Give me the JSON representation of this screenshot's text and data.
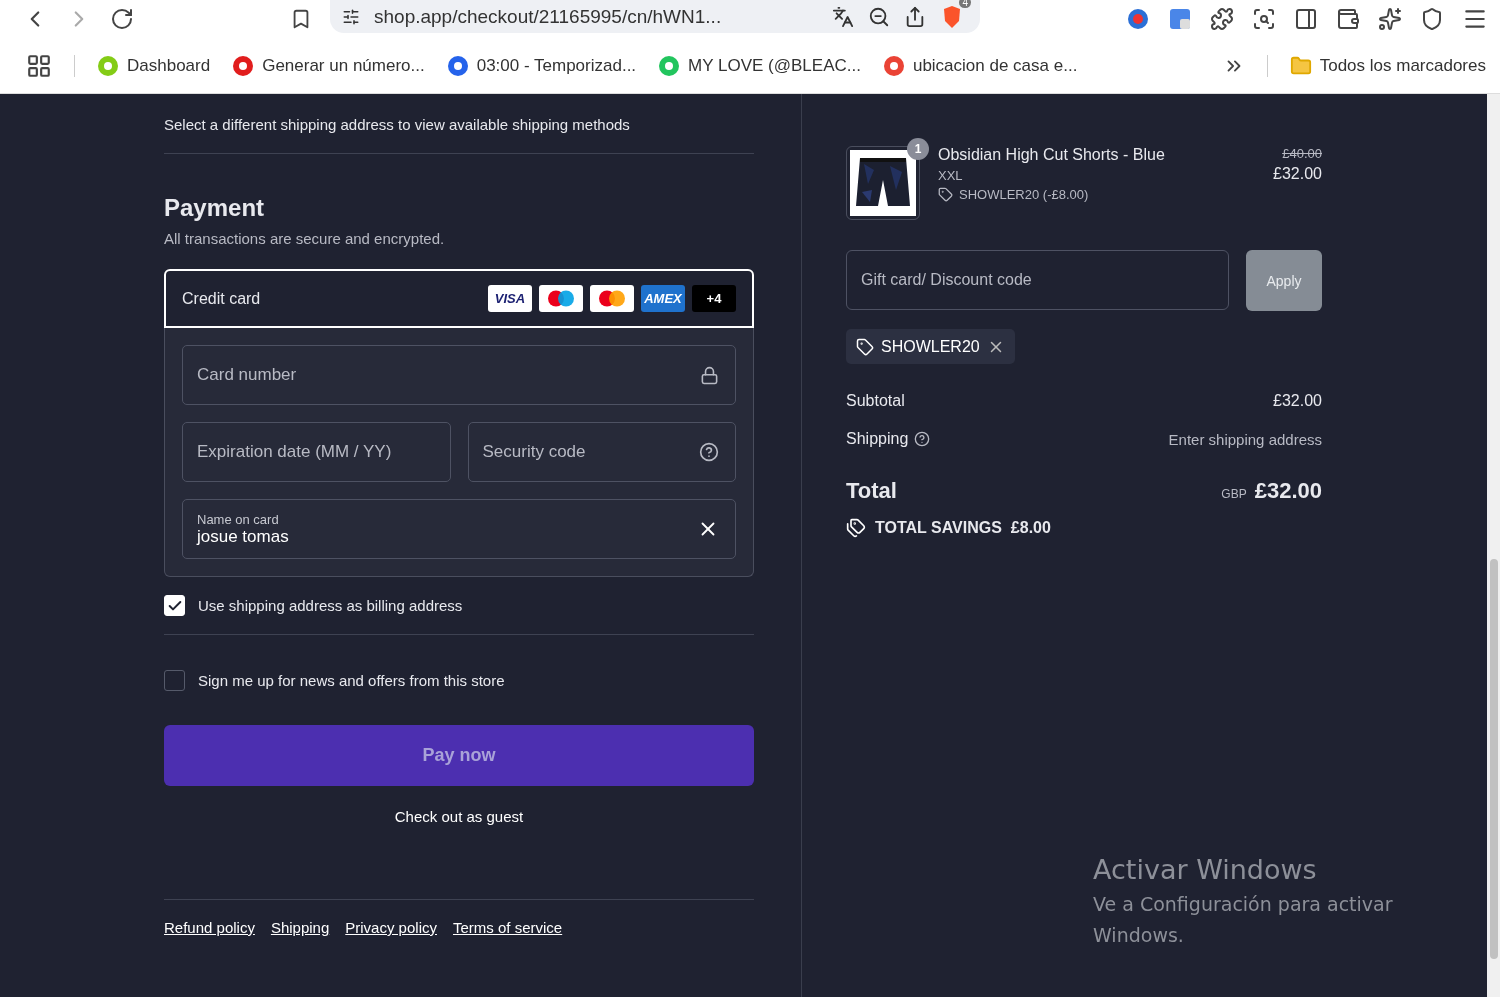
{
  "browser": {
    "url": "shop.app/checkout/21165995/cn/hWN1...",
    "extension_badge": "4",
    "bookmarks": [
      {
        "label": "Dashboard",
        "color": "#84cc16"
      },
      {
        "label": "Generar un número...",
        "color": "#e11d1d"
      },
      {
        "label": "03:00 - Temporizad...",
        "color": "#2563eb"
      },
      {
        "label": "MY LOVE (@BLEAC...",
        "color": "#22c55e"
      },
      {
        "label": "ubicacion de casa e...",
        "color": "#ea4335"
      }
    ],
    "all_bookmarks": "Todos los marcadores"
  },
  "shipping": {
    "message": "Select a different shipping address to view available shipping methods"
  },
  "payment": {
    "title": "Payment",
    "subtitle": "All transactions are secure and encrypted.",
    "method": {
      "label": "Credit card",
      "selected": true,
      "cards": [
        {
          "kind": "visa",
          "label": "VISA"
        },
        {
          "kind": "maestro"
        },
        {
          "kind": "mastercard"
        },
        {
          "kind": "amex",
          "label": "AMEX"
        },
        {
          "kind": "more",
          "label": "+4"
        }
      ]
    },
    "card_number": {
      "placeholder": "Card number"
    },
    "expiration": {
      "placeholder": "Expiration date (MM / YY)"
    },
    "security_code": {
      "placeholder": "Security code"
    },
    "name_on_card": {
      "label": "Name on card",
      "value": "josue tomas"
    }
  },
  "billing_same": {
    "label": "Use shipping address as billing address",
    "checked": true
  },
  "newsletter": {
    "label": "Sign me up for news and offers from this store",
    "checked": false
  },
  "pay_button": {
    "label": "Pay now",
    "disabled": true
  },
  "guest_link": "Check out as guest",
  "footer_links": [
    "Refund policy",
    "Shipping",
    "Privacy policy",
    "Terms of service"
  ],
  "summary": {
    "item": {
      "quantity": "1",
      "name": "Obsidian High Cut Shorts - Blue",
      "variant": "XXL",
      "discount": "SHOWLER20 (-£8.00)",
      "original_price": "£40.00",
      "price": "£32.00"
    },
    "discount_field": {
      "placeholder": "Gift card/ Discount code"
    },
    "apply_button": {
      "label": "Apply",
      "disabled": true
    },
    "applied_codes": [
      {
        "code": "SHOWLER20"
      }
    ],
    "subtotal": {
      "label": "Subtotal",
      "value": "£32.00"
    },
    "shipping": {
      "label": "Shipping",
      "value": "Enter shipping address"
    },
    "total": {
      "label": "Total",
      "currency": "GBP",
      "value": "£32.00"
    },
    "savings": {
      "label": "TOTAL SAVINGS",
      "value": "£8.00"
    }
  },
  "os_notice": {
    "title": "Activar Windows",
    "message": "Ve a Configuración para activar Windows."
  }
}
